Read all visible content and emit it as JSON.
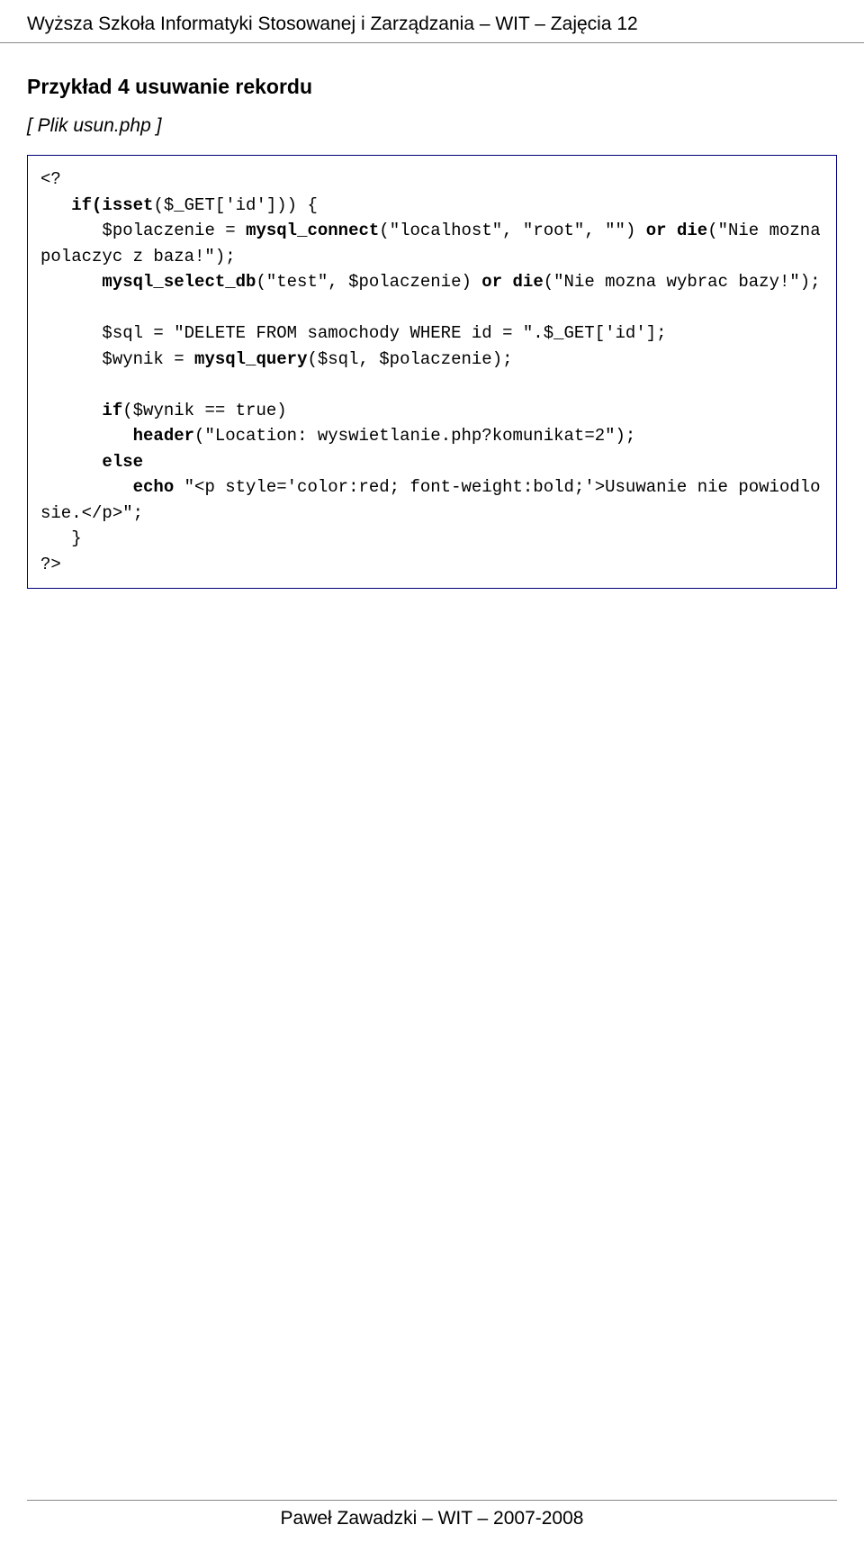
{
  "header": "Wyższa Szkoła Informatyki Stosowanej i Zarządzania – WIT – Zajęcia 12",
  "footer": "Paweł Zawadzki – WIT – 2007-2008",
  "section_title": "Przykład 4 usuwanie rekordu",
  "file_label": "[ Plik usun.php ]",
  "code": {
    "l1": "<?",
    "l2": "   ",
    "l2b": "if(isset",
    "l2c": "($_GET['id'])) {",
    "l3": "      $polaczenie = ",
    "l3b": "mysql_connect",
    "l3c": "(\"localhost\", \"root\", \"\") ",
    "l3d": "or",
    "l3e": " ",
    "l3f": "die",
    "l3g": "(\"Nie mozna polaczyc z baza!\");",
    "l4": "      ",
    "l4b": "mysql_select_db",
    "l4c": "(\"test\", $polaczenie) ",
    "l4d": "or",
    "l4e": " ",
    "l4f": "die",
    "l4g": "(\"Nie mozna wybrac bazy!\");",
    "l5": "",
    "l6": "      $sql = \"DELETE FROM samochody WHERE id = \".$_GET['id'];",
    "l7": "      $wynik = ",
    "l7b": "mysql_query",
    "l7c": "($sql, $polaczenie);",
    "l8": "",
    "l9": "      ",
    "l9b": "if",
    "l9c": "($wynik == true)",
    "l10": "         ",
    "l10b": "header",
    "l10c": "(\"Location: wyswietlanie.php?komunikat=2\");",
    "l11": "      ",
    "l11b": "else",
    "l12": "         ",
    "l12b": "echo",
    "l12c": " \"<p style='color:red; font-weight:bold;'>Usuwanie nie powiodlo sie.</p>\";",
    "l13": "   }",
    "l14": "?>"
  }
}
